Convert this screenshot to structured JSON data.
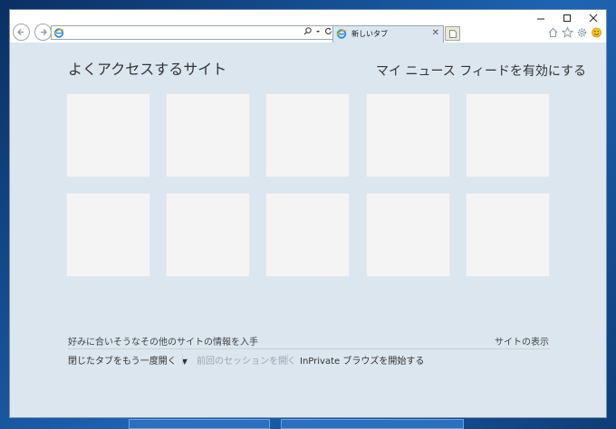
{
  "browser": {
    "address": {
      "value": ""
    },
    "tab": {
      "label": "新しいタブ"
    }
  },
  "new_tab_page": {
    "frequent_sites_heading": "よくアクセスするサイト",
    "news_feed_link": "マイ ニュース フィードを有効にする",
    "tiles": [
      {
        "label": ""
      },
      {
        "label": ""
      },
      {
        "label": ""
      },
      {
        "label": ""
      },
      {
        "label": ""
      },
      {
        "label": ""
      },
      {
        "label": ""
      },
      {
        "label": ""
      },
      {
        "label": ""
      },
      {
        "label": ""
      }
    ],
    "suggested_sites_text": "好みに合いそうなその他のサイトの情報を入手",
    "show_sites_link": "サイトの表示",
    "reopen_closed_tabs": "閉じたタブをもう一度開く",
    "reopen_last_session": "前回のセッションを開く",
    "start_inprivate": "InPrivate ブラウズを開始する"
  },
  "icons": [
    "back-icon",
    "forward-icon",
    "ie-logo-icon",
    "search-icon",
    "dropdown-icon",
    "refresh-icon",
    "close-tab-icon",
    "new-tab-icon",
    "home-icon",
    "favorites-icon",
    "settings-icon",
    "feedback-smiley-icon",
    "minimize-icon",
    "maximize-icon",
    "close-icon"
  ],
  "colors": {
    "page_background": "#dbe6ef",
    "tile": "#f4f4f4",
    "desktop": "#1b4f86"
  }
}
